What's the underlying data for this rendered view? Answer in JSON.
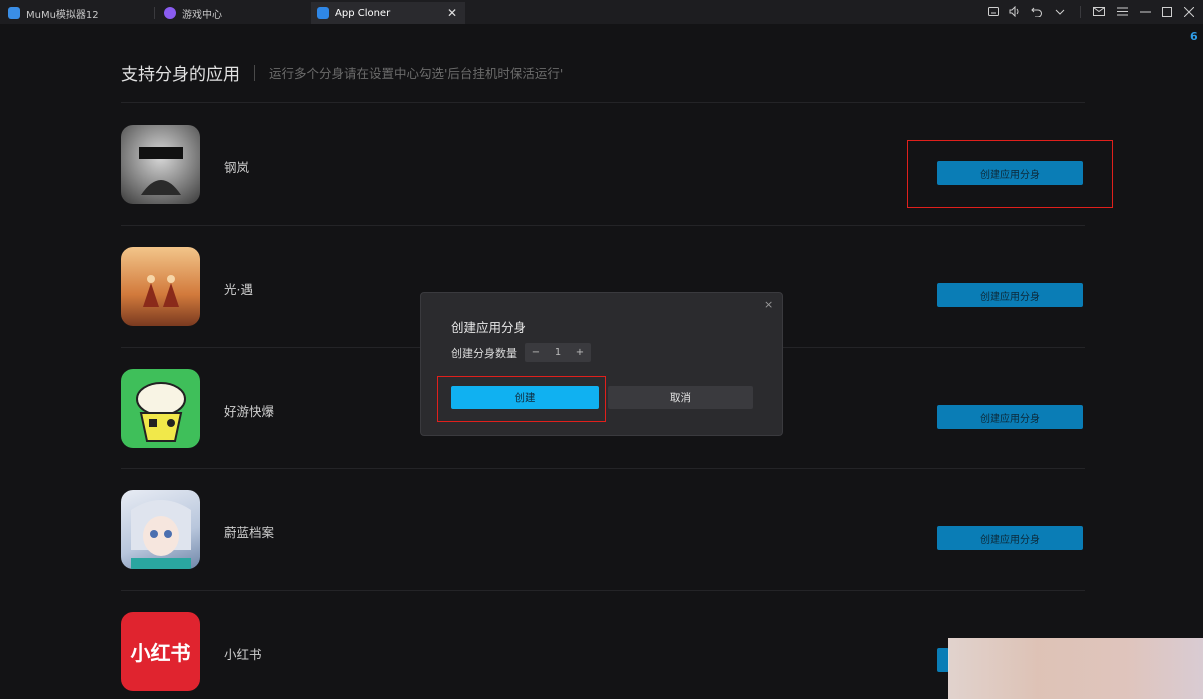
{
  "tabs": [
    {
      "label": "MuMu模拟器12",
      "icon": "mumu-logo-icon"
    },
    {
      "label": "游戏中心",
      "icon": "gamepad-icon"
    },
    {
      "label": "App Cloner",
      "icon": "app-cloner-icon",
      "active": true
    }
  ],
  "window_controls": [
    "keyboard-icon",
    "volume-icon",
    "undo-icon",
    "chevron-down-icon",
    "mail-icon",
    "menu-icon",
    "minimize-icon",
    "maximize-icon",
    "close-icon"
  ],
  "tab_close": "✕",
  "badge": "6",
  "header": {
    "title": "支持分身的应用",
    "subtitle": "运行多个分身请在设置中心勾选'后台挂机时保活运行'"
  },
  "apps": [
    {
      "name": "钢岚",
      "button": "创建应用分身"
    },
    {
      "name": "光·遇",
      "button": "创建应用分身"
    },
    {
      "name": "好游快爆",
      "button": "创建应用分身"
    },
    {
      "name": "蔚蓝档案",
      "button": "创建应用分身"
    },
    {
      "name": "小红书",
      "button": "创建应用分身",
      "icon_text": "小红书"
    }
  ],
  "dialog": {
    "title": "创建应用分身",
    "count_label": "创建分身数量",
    "minus": "−",
    "count_value": "1",
    "plus": "+",
    "create_label": "创建",
    "cancel_label": "取消",
    "close": "×"
  },
  "colors": {
    "accent": "#10b1f1",
    "button": "#0a7db6",
    "highlight": "#e0201c",
    "background": "#131315"
  }
}
